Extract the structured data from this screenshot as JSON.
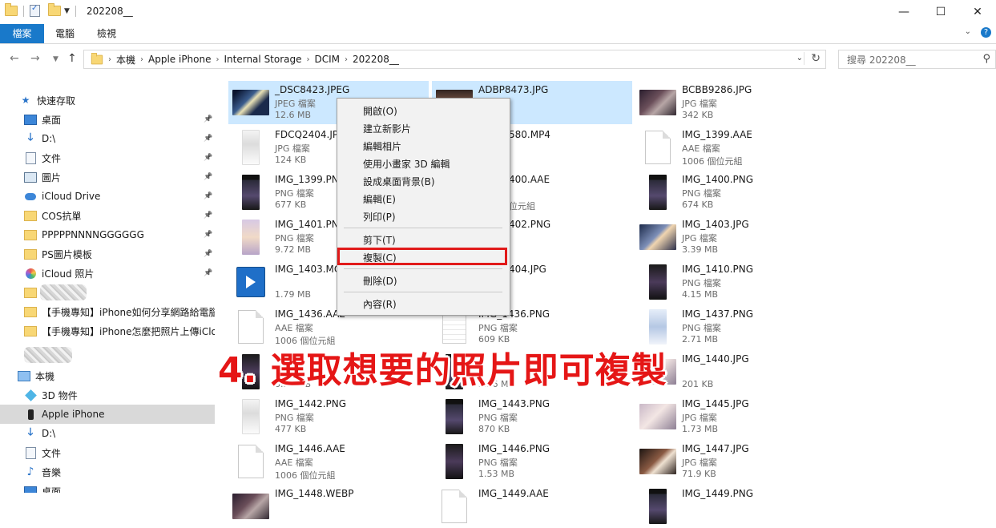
{
  "window": {
    "title": "202208__",
    "controls": {
      "minimize": "—",
      "maximize": "☐",
      "close": "✕"
    }
  },
  "ribbon": {
    "tabs": [
      "檔案",
      "電腦",
      "檢視"
    ],
    "chevron": "⌄",
    "help": "?"
  },
  "address": {
    "crumbs": [
      "本機",
      "Apple iPhone",
      "Internal Storage",
      "DCIM",
      "202208__"
    ],
    "search_placeholder": "搜尋 202208__"
  },
  "sidebar": {
    "items": [
      {
        "label": "快速存取",
        "icon": "star-icon"
      },
      {
        "label": "桌面",
        "icon": "desktop-icon",
        "pinned": true
      },
      {
        "label": "D:\\",
        "icon": "download-icon",
        "pinned": true
      },
      {
        "label": "文件",
        "icon": "document-icon",
        "pinned": true
      },
      {
        "label": "圖片",
        "icon": "picture-icon",
        "pinned": true
      },
      {
        "label": "iCloud Drive",
        "icon": "cloud-icon",
        "pinned": true
      },
      {
        "label": "COS抗單",
        "icon": "folder-icon",
        "pinned": true
      },
      {
        "label": "PPPPPNNNNGGGGGG",
        "icon": "folder-icon",
        "pinned": true
      },
      {
        "label": "PS圖片模板",
        "icon": "folder-icon",
        "pinned": true
      },
      {
        "label": "iCloud 照片",
        "icon": "photos-icon",
        "pinned": true
      },
      {
        "label": "",
        "icon": "folder-icon"
      },
      {
        "label": "【手機專知】iPhone如何分享網路給電腦",
        "icon": "folder-icon"
      },
      {
        "label": "【手機專知】iPhone怎麼把照片上傳iCloud",
        "icon": "folder-icon"
      },
      {
        "label": "",
        "icon": "blurred"
      },
      {
        "label": "本機",
        "icon": "pc-icon"
      },
      {
        "label": "3D 物件",
        "icon": "cube-icon"
      },
      {
        "label": "Apple iPhone",
        "icon": "phone-icon",
        "selected": true
      },
      {
        "label": "D:\\",
        "icon": "download-icon"
      },
      {
        "label": "文件",
        "icon": "document-icon"
      },
      {
        "label": "音樂",
        "icon": "music-icon"
      },
      {
        "label": "桌面",
        "icon": "desktop-icon"
      }
    ]
  },
  "files": [
    {
      "name": "_DSC8423.JPEG",
      "type": "JPEG 檔案",
      "size": "12.6 MB",
      "thumb": "t-dark1",
      "shape": "land",
      "selected": true
    },
    {
      "name": "ADBP8473.JPG",
      "type": "",
      "size": "",
      "thumb": "t-dark2",
      "shape": "land",
      "selected": true
    },
    {
      "name": "BCBB9286.JPG",
      "type": "JPG 檔案",
      "size": "342 KB",
      "thumb": "t-dark3",
      "shape": "land"
    },
    {
      "name": "FDCQ2404.JPG",
      "type": "JPG 檔案",
      "size": "124 KB",
      "thumb": "t-light",
      "shape": "port"
    },
    {
      "name": "580.MP4",
      "type": "",
      "size": "",
      "thumb": "none",
      "shape": "none"
    },
    {
      "name": "IMG_1399.AAE",
      "type": "AAE 檔案",
      "size": "1006 個位元組",
      "thumb": "doc",
      "shape": "doc"
    },
    {
      "name": "IMG_1399.PNG",
      "type": "PNG 檔案",
      "size": "677 KB",
      "thumb": "t-phone",
      "shape": "port"
    },
    {
      "name": "400.AAE",
      "type": "",
      "size": "位元組",
      "thumb": "none",
      "shape": "none"
    },
    {
      "name": "IMG_1400.PNG",
      "type": "PNG 檔案",
      "size": "674 KB",
      "thumb": "t-phone",
      "shape": "port"
    },
    {
      "name": "IMG_1401.PNG",
      "type": "PNG 檔案",
      "size": "9.72 MB",
      "thumb": "t-anime",
      "shape": "port"
    },
    {
      "name": "402.PNG",
      "type": "",
      "size": "",
      "thumb": "none",
      "shape": "none"
    },
    {
      "name": "IMG_1403.JPG",
      "type": "JPG 檔案",
      "size": "3.39 MB",
      "thumb": "t-sky",
      "shape": "land"
    },
    {
      "name": "IMG_1403.MOV",
      "type": "",
      "size": "1.79 MB",
      "thumb": "media",
      "shape": "media"
    },
    {
      "name": "404.JPG",
      "type": "",
      "size": "",
      "thumb": "none",
      "shape": "none"
    },
    {
      "name": "IMG_1410.PNG",
      "type": "PNG 檔案",
      "size": "4.15 MB",
      "thumb": "t-phone2",
      "shape": "port"
    },
    {
      "name": "IMG_1436.AAE",
      "type": "AAE 檔案",
      "size": "1006 個位元組",
      "thumb": "doc",
      "shape": "doc"
    },
    {
      "name": "IMG_1436.PNG",
      "type": "PNG 檔案",
      "size": "609 KB",
      "thumb": "sheet",
      "shape": "sheet"
    },
    {
      "name": "IMG_1437.PNG",
      "type": "PNG 檔案",
      "size": "2.71 MB",
      "thumb": "t-blue",
      "shape": "port"
    },
    {
      "name": "",
      "type": "",
      "size": "3.26 MB",
      "thumb": "t-phone2",
      "shape": "port"
    },
    {
      "name": "",
      "type": "",
      "size": "3.26 MB",
      "thumb": "t-phone",
      "shape": "port"
    },
    {
      "name": "IMG_1440.JPG",
      "type": "",
      "size": "201 KB",
      "thumb": "t-face",
      "shape": "land"
    },
    {
      "name": "IMG_1442.PNG",
      "type": "PNG 檔案",
      "size": "477 KB",
      "thumb": "t-light",
      "shape": "port"
    },
    {
      "name": "IMG_1443.PNG",
      "type": "PNG 檔案",
      "size": "870 KB",
      "thumb": "t-phone",
      "shape": "port"
    },
    {
      "name": "IMG_1445.JPG",
      "type": "JPG 檔案",
      "size": "1.73 MB",
      "thumb": "t-face",
      "shape": "land"
    },
    {
      "name": "IMG_1446.AAE",
      "type": "AAE 檔案",
      "size": "1006 個位元組",
      "thumb": "doc",
      "shape": "doc"
    },
    {
      "name": "IMG_1446.PNG",
      "type": "PNG 檔案",
      "size": "1.53 MB",
      "thumb": "t-phone2",
      "shape": "port"
    },
    {
      "name": "IMG_1447.JPG",
      "type": "JPG 檔案",
      "size": "71.9 KB",
      "thumb": "t-dog",
      "shape": "land"
    },
    {
      "name": "IMG_1448.WEBP",
      "type": "",
      "size": "",
      "thumb": "t-dark3",
      "shape": "land"
    },
    {
      "name": "IMG_1449.AAE",
      "type": "",
      "size": "",
      "thumb": "doc",
      "shape": "doc"
    },
    {
      "name": "IMG_1449.PNG",
      "type": "",
      "size": "",
      "thumb": "t-phone",
      "shape": "port"
    }
  ],
  "context_menu": {
    "items": [
      "開啟(O)",
      "建立新影片",
      "編輯相片",
      "使用小畫家 3D 編輯",
      "設成桌面背景(B)",
      "編輯(E)",
      "列印(P)",
      "剪下(T)",
      "複製(C)",
      "刪除(D)",
      "內容(R)"
    ]
  },
  "annotation": {
    "text": "4. 選取想要的照片即可複製",
    "color": "#e51616"
  },
  "colors": {
    "accent": "#1979ca",
    "selection": "#cce8ff",
    "highlight": "#e11a1a"
  }
}
